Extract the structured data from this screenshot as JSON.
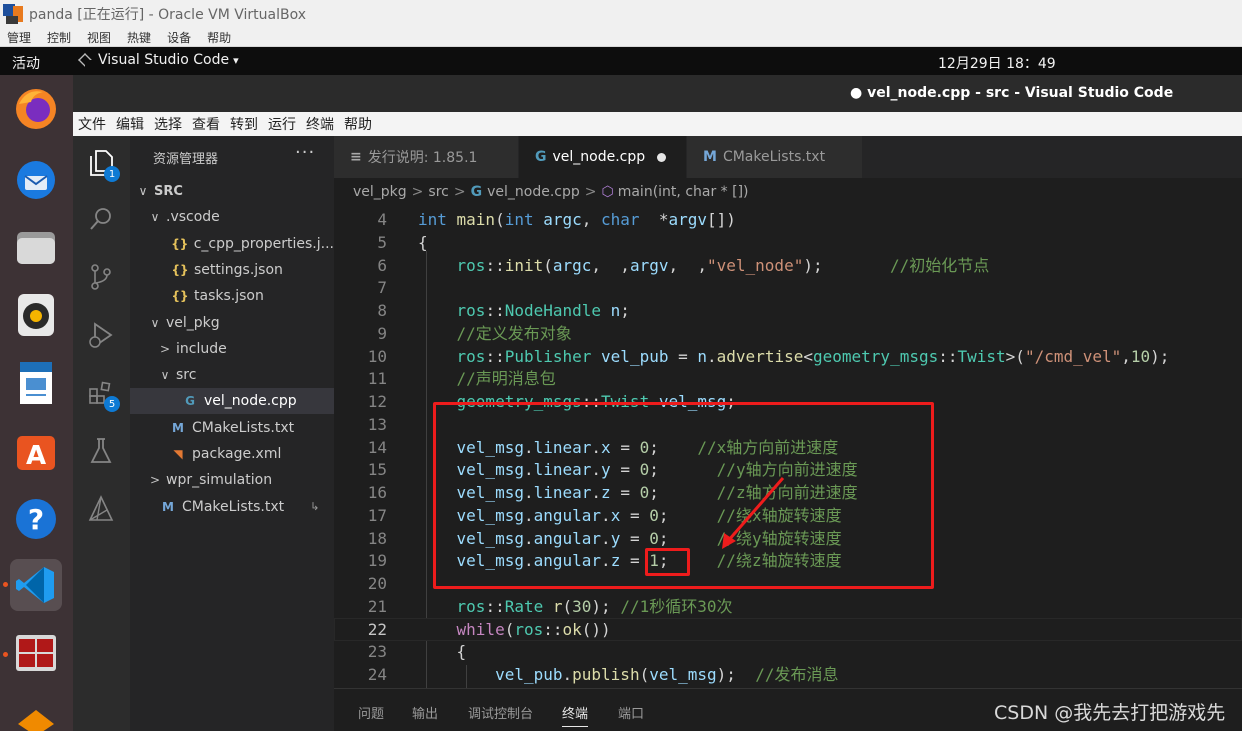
{
  "vbox": {
    "title": "panda [正在运行] - Oracle VM VirtualBox",
    "menu": [
      "管理",
      "控制",
      "视图",
      "热键",
      "设备",
      "帮助"
    ]
  },
  "gnome": {
    "activities": "活动",
    "app_name": "Visual Studio Code",
    "app_arrow": "▾",
    "clock": "12月29日  18：49"
  },
  "window": {
    "title": "● vel_node.cpp - src - Visual Studio Code"
  },
  "menubar": [
    "文件",
    "编辑",
    "选择",
    "查看",
    "转到",
    "运行",
    "终端",
    "帮助"
  ],
  "activity": {
    "explorer_badge": "1",
    "extensions_badge": "5"
  },
  "explorer": {
    "title": "资源管理器",
    "more": "···",
    "rows": [
      {
        "chev": "∨",
        "icon": "",
        "label": "SRC",
        "indent": 6,
        "bold": true
      },
      {
        "chev": "∨",
        "icon": "",
        "label": ".vscode",
        "indent": 18
      },
      {
        "chev": "",
        "icon": "{}",
        "label": "c_cpp_properties.j...",
        "indent": 26,
        "kind": "json"
      },
      {
        "chev": "",
        "icon": "{}",
        "label": "settings.json",
        "indent": 26,
        "kind": "json"
      },
      {
        "chev": "",
        "icon": "{}",
        "label": "tasks.json",
        "indent": 26,
        "kind": "json"
      },
      {
        "chev": "∨",
        "icon": "",
        "label": "vel_pkg",
        "indent": 18
      },
      {
        "chev": ">",
        "icon": "",
        "label": "include",
        "indent": 28
      },
      {
        "chev": "∨",
        "icon": "",
        "label": "src",
        "indent": 28
      },
      {
        "chev": "",
        "icon": "G",
        "label": "vel_node.cpp",
        "indent": 36,
        "kind": "cpp",
        "selected": true
      },
      {
        "chev": "",
        "icon": "M",
        "label": "CMakeLists.txt",
        "indent": 24,
        "kind": "cm"
      },
      {
        "chev": "",
        "icon": "◥",
        "label": "package.xml",
        "indent": 24,
        "kind": "xml"
      },
      {
        "chev": ">",
        "icon": "",
        "label": "wpr_simulation",
        "indent": 18
      },
      {
        "chev": "",
        "icon": "M",
        "label": "CMakeLists.txt",
        "indent": 14,
        "kind": "cm",
        "suffix": "↳"
      }
    ]
  },
  "tabs": [
    {
      "icon": "≡",
      "label": "发行说明: 1.85.1"
    },
    {
      "icon": "G",
      "label": "vel_node.cpp",
      "active": true,
      "modified": true
    },
    {
      "icon": "M",
      "label": "CMakeLists.txt"
    }
  ],
  "breadcrumb": [
    "vel_pkg",
    "src",
    "vel_node.cpp",
    "main(int, char * [])"
  ],
  "code": {
    "current_line": 22,
    "lines": [
      {
        "n": "4",
        "t": [
          [
            "kw",
            "int "
          ],
          [
            "fn",
            "main"
          ],
          [
            "",
            "("
          ],
          [
            "kw",
            "int "
          ],
          [
            "va",
            "argc"
          ],
          [
            "",
            ", "
          ],
          [
            "kw",
            "char  "
          ],
          [
            "",
            "*"
          ],
          [
            "va",
            "argv"
          ],
          [
            "",
            "[])"
          ]
        ]
      },
      {
        "n": "5",
        "t": [
          [
            "",
            "{"
          ]
        ]
      },
      {
        "n": "6",
        "t": [
          [
            "",
            "    "
          ],
          [
            "ty",
            "ros"
          ],
          [
            "",
            "::"
          ],
          [
            "fn",
            "init"
          ],
          [
            "",
            "("
          ],
          [
            "va",
            "argc"
          ],
          [
            "",
            ",  ,"
          ],
          [
            "va",
            "argv"
          ],
          [
            "",
            ",  ,"
          ],
          [
            "st",
            "\"vel_node\""
          ],
          [
            "",
            ");       "
          ],
          [
            "cm",
            "//初始化节点"
          ]
        ]
      },
      {
        "n": "7",
        "t": [
          [
            "",
            ""
          ]
        ]
      },
      {
        "n": "8",
        "t": [
          [
            "",
            "    "
          ],
          [
            "ty",
            "ros"
          ],
          [
            "",
            "::"
          ],
          [
            "ty",
            "NodeHandle"
          ],
          [
            "",
            ""
          ],
          [
            "va",
            " n"
          ],
          [
            "",
            ";"
          ]
        ]
      },
      {
        "n": "9",
        "t": [
          [
            "",
            "    "
          ],
          [
            "cm",
            "//定义发布对象"
          ]
        ]
      },
      {
        "n": "10",
        "t": [
          [
            "",
            "    "
          ],
          [
            "ty",
            "ros"
          ],
          [
            "",
            "::"
          ],
          [
            "ty",
            "Publisher"
          ],
          [
            "va",
            " vel_pub"
          ],
          [
            "",
            " = "
          ],
          [
            "va",
            "n"
          ],
          [
            "",
            "."
          ],
          [
            "fn",
            "advertise"
          ],
          [
            "",
            "<"
          ],
          [
            "ty",
            "geometry_msgs"
          ],
          [
            "",
            "::"
          ],
          [
            "ty",
            "Twist"
          ],
          [
            "",
            ">("
          ],
          [
            "st",
            "\"/cmd_vel\""
          ],
          [
            "",
            ","
          ],
          [
            "nu",
            "10"
          ],
          [
            "",
            ");"
          ]
        ]
      },
      {
        "n": "11",
        "t": [
          [
            "",
            "    "
          ],
          [
            "cm",
            "//声明消息包"
          ]
        ]
      },
      {
        "n": "12",
        "t": [
          [
            "",
            "    "
          ],
          [
            "ty",
            "geometry_msgs"
          ],
          [
            "",
            "::"
          ],
          [
            "ty",
            "Twist"
          ],
          [
            "va",
            " vel_msg"
          ],
          [
            "",
            ";"
          ]
        ]
      },
      {
        "n": "13",
        "t": [
          [
            "",
            ""
          ]
        ]
      },
      {
        "n": "14",
        "t": [
          [
            "",
            "    "
          ],
          [
            "va",
            "vel_msg"
          ],
          [
            "",
            "."
          ],
          [
            "va",
            "linear"
          ],
          [
            "",
            "."
          ],
          [
            "va",
            "x"
          ],
          [
            "",
            " = "
          ],
          [
            "nu",
            "0"
          ],
          [
            "",
            ";    "
          ],
          [
            "cm",
            "//x轴方向前进速度"
          ]
        ]
      },
      {
        "n": "15",
        "t": [
          [
            "",
            "    "
          ],
          [
            "va",
            "vel_msg"
          ],
          [
            "",
            "."
          ],
          [
            "va",
            "linear"
          ],
          [
            "",
            "."
          ],
          [
            "va",
            "y"
          ],
          [
            "",
            " = "
          ],
          [
            "nu",
            "0"
          ],
          [
            "",
            ";      "
          ],
          [
            "cm",
            "//y轴方向前进速度"
          ]
        ]
      },
      {
        "n": "16",
        "t": [
          [
            "",
            "    "
          ],
          [
            "va",
            "vel_msg"
          ],
          [
            "",
            "."
          ],
          [
            "va",
            "linear"
          ],
          [
            "",
            "."
          ],
          [
            "va",
            "z"
          ],
          [
            "",
            " = "
          ],
          [
            "nu",
            "0"
          ],
          [
            "",
            ";      "
          ],
          [
            "cm",
            "//z轴方向前进速度"
          ]
        ]
      },
      {
        "n": "17",
        "t": [
          [
            "",
            "    "
          ],
          [
            "va",
            "vel_msg"
          ],
          [
            "",
            "."
          ],
          [
            "va",
            "angular"
          ],
          [
            "",
            "."
          ],
          [
            "va",
            "x"
          ],
          [
            "",
            " = "
          ],
          [
            "nu",
            "0"
          ],
          [
            "",
            ";     "
          ],
          [
            "cm",
            "//绕x轴旋转速度"
          ]
        ]
      },
      {
        "n": "18",
        "t": [
          [
            "",
            "    "
          ],
          [
            "va",
            "vel_msg"
          ],
          [
            "",
            "."
          ],
          [
            "va",
            "angular"
          ],
          [
            "",
            "."
          ],
          [
            "va",
            "y"
          ],
          [
            "",
            " = "
          ],
          [
            "nu",
            "0"
          ],
          [
            "",
            ";     "
          ],
          [
            "cm",
            "//绕y轴旋转速度"
          ]
        ]
      },
      {
        "n": "19",
        "t": [
          [
            "",
            "    "
          ],
          [
            "va",
            "vel_msg"
          ],
          [
            "",
            "."
          ],
          [
            "va",
            "angular"
          ],
          [
            "",
            "."
          ],
          [
            "va",
            "z"
          ],
          [
            "",
            " = "
          ],
          [
            "nu",
            "1"
          ],
          [
            "",
            ";     "
          ],
          [
            "cm",
            "//绕z轴旋转速度"
          ]
        ]
      },
      {
        "n": "20",
        "t": [
          [
            "",
            ""
          ]
        ]
      },
      {
        "n": "21",
        "t": [
          [
            "",
            "    "
          ],
          [
            "ty",
            "ros"
          ],
          [
            "",
            "::"
          ],
          [
            "ty",
            "Rate"
          ],
          [
            "",
            ""
          ],
          [
            "fn",
            " r"
          ],
          [
            "",
            "("
          ],
          [
            "nu",
            "30"
          ],
          [
            "",
            "); "
          ],
          [
            "cm",
            "//1秒循环30次"
          ]
        ]
      },
      {
        "n": "22",
        "t": [
          [
            "",
            "    "
          ],
          [
            "ctl",
            "while"
          ],
          [
            "",
            "("
          ],
          [
            "ty",
            "ros"
          ],
          [
            "",
            "::"
          ],
          [
            "fn",
            "ok"
          ],
          [
            "",
            "())"
          ]
        ]
      },
      {
        "n": "23",
        "t": [
          [
            "",
            "    {"
          ]
        ]
      },
      {
        "n": "24",
        "t": [
          [
            "",
            "        "
          ],
          [
            "va",
            "vel_pub"
          ],
          [
            "",
            "."
          ],
          [
            "fn",
            "publish"
          ],
          [
            "",
            "("
          ],
          [
            "va",
            "vel_msg"
          ],
          [
            "",
            ");  "
          ],
          [
            "cm",
            "//发布消息"
          ]
        ]
      }
    ]
  },
  "panel": [
    "问题",
    "输出",
    "调试控制台",
    "终端",
    "端口"
  ],
  "panel_active": "终端",
  "watermark": "CSDN @我先去打把游戏先",
  "colors": {
    "annotation": "#ee1c1c",
    "accent": "#0e7ad4",
    "ubuntu_orange": "#e95420"
  }
}
